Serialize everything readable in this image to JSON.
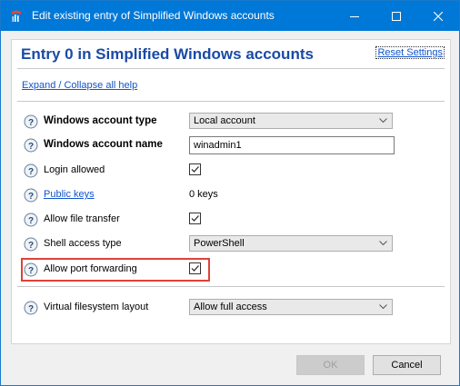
{
  "window": {
    "title": "Edit existing entry of Simplified Windows accounts",
    "colors": {
      "titlebar": "#0078d7",
      "heading": "#1a4aa6",
      "link": "#1155cc",
      "highlight": "#e0413a"
    },
    "icons": [
      "app-icon",
      "minimize-icon",
      "maximize-icon",
      "close-icon"
    ]
  },
  "panel": {
    "heading": "Entry 0 in Simplified Windows accounts",
    "reset_label": "Reset Settings",
    "expand_label": "Expand / Collapse all help"
  },
  "fields": [
    {
      "label": "Windows account type",
      "value": "Local account",
      "kind": "select"
    },
    {
      "label": "Windows account name",
      "value": "winadmin1",
      "kind": "text"
    },
    {
      "label": "Login allowed",
      "checked": true,
      "kind": "checkbox"
    },
    {
      "label": "Public keys",
      "value": "0 keys",
      "kind": "link"
    },
    {
      "label": "Allow file transfer",
      "checked": true,
      "kind": "checkbox"
    },
    {
      "label": "Shell access type",
      "value": "PowerShell",
      "kind": "select"
    },
    {
      "label": "Allow port forwarding",
      "checked": true,
      "kind": "checkbox"
    },
    {
      "label": "Virtual filesystem layout",
      "value": "Allow full access",
      "kind": "select"
    }
  ],
  "buttons": {
    "ok": "OK",
    "cancel": "Cancel"
  }
}
